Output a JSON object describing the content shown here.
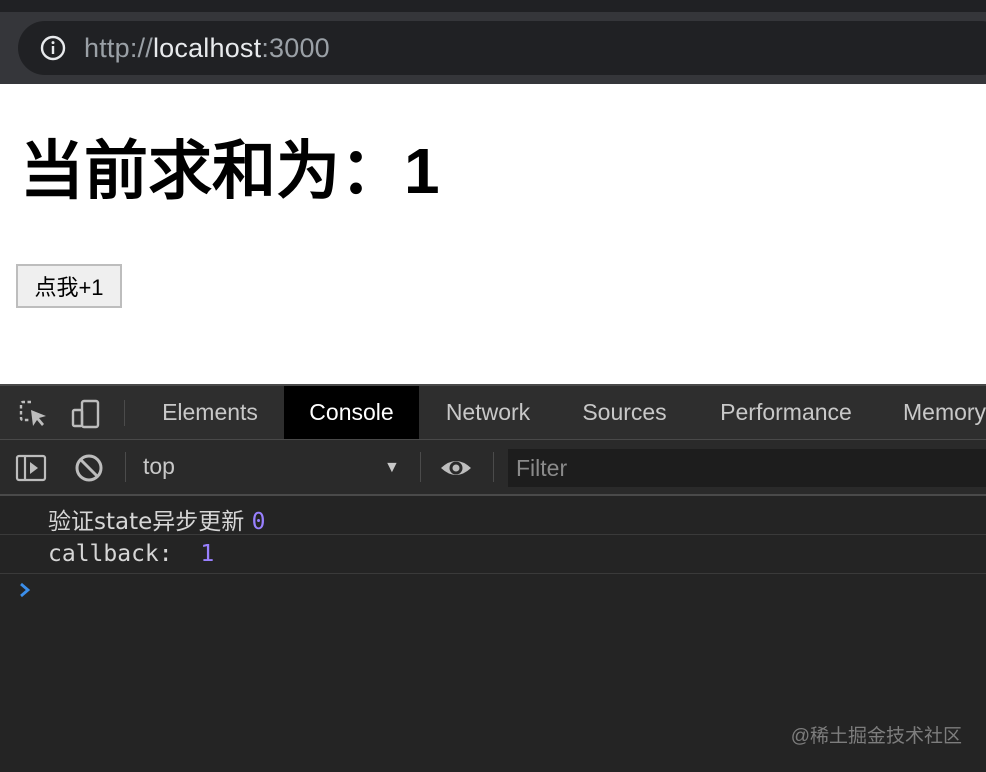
{
  "browser": {
    "url_scheme": "http://",
    "url_host": "localhost",
    "url_port": ":3000"
  },
  "page": {
    "title": "当前求和为：1",
    "button_label": "点我+1"
  },
  "devtools": {
    "tabs": [
      {
        "label": "Elements"
      },
      {
        "label": "Console",
        "active": true
      },
      {
        "label": "Network"
      },
      {
        "label": "Sources"
      },
      {
        "label": "Performance"
      },
      {
        "label": "Memory"
      }
    ],
    "context": "top",
    "filter_placeholder": "Filter",
    "logs": [
      {
        "text": "验证state异步更新 ",
        "value": "0"
      },
      {
        "text": "callback:  ",
        "value": "1"
      }
    ]
  },
  "watermark": "@稀土掘金技术社区",
  "icons": {
    "url_info": "info-icon",
    "inspect": "inspect-element-icon",
    "device": "device-toolbar-icon",
    "sidebar": "sidebar-toggle-icon",
    "clear": "clear-console-icon",
    "eye": "live-expression-icon",
    "prompt": "chevron-right-icon"
  },
  "colors": {
    "active_tab_bg": "#000000",
    "log_number": "#9980ff",
    "prompt": "#3b8eea"
  }
}
